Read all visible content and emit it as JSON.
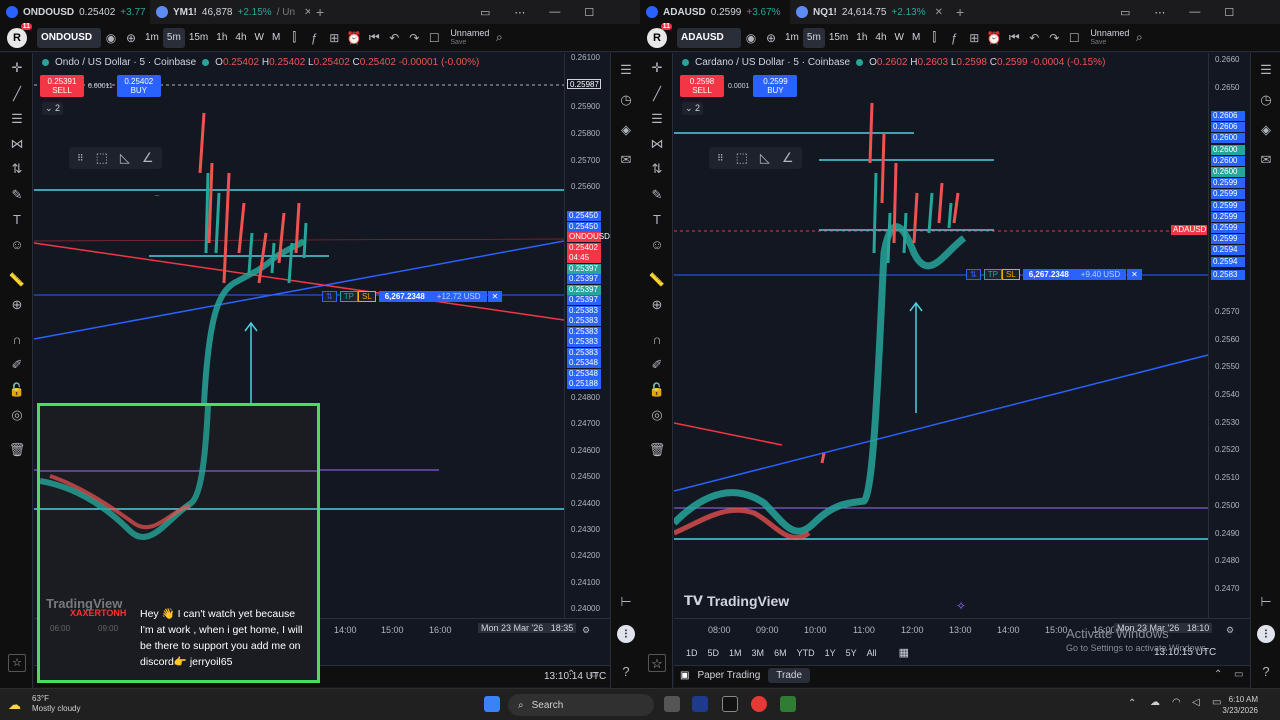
{
  "left": {
    "tabs": [
      {
        "symbol": "ONDOUSD",
        "price": "0.25402",
        "change": "+3.77",
        "active": true
      },
      {
        "symbol": "YM1!",
        "price": "46,878",
        "change": "+2.15%",
        "suffix": "/ Un",
        "active": false
      }
    ],
    "symbol_field": "ONDOUSD",
    "intervals": [
      "1m",
      "5m",
      "15m",
      "1h",
      "4h",
      "W",
      "M"
    ],
    "selected_interval": "5m",
    "layout_name": "Unnamed",
    "layout_sub": "Save",
    "legend": {
      "title": "Ondo / US Dollar · 5 · Coinbase",
      "o": "0.25402",
      "h": "0.25402",
      "l": "0.25402",
      "c": "0.25402",
      "chg": "-0.00001 (-0.00%)"
    },
    "sell": {
      "price": "0.25391",
      "label": "SELL"
    },
    "buy": {
      "price": "0.25402",
      "label": "BUY"
    },
    "spread": "0.00011",
    "collapse": "2",
    "price_levels": [
      "0.26100",
      "0.25900",
      "0.25800",
      "0.25700",
      "0.25600",
      "0.25500",
      "0.25200",
      "0.25100",
      "0.25000",
      "0.24900",
      "0.24800",
      "0.24700",
      "0.24600",
      "0.24500",
      "0.24400",
      "0.24300",
      "0.24200",
      "0.24100",
      "0.24000"
    ],
    "top_tag": "0.25987",
    "price_tags": [
      {
        "v": "0.25450",
        "c": "#2962ff"
      },
      {
        "v": "0.25450",
        "c": "#2962ff"
      },
      {
        "v": "ONDOUSD",
        "c": "#f23645"
      },
      {
        "v": "0.25402",
        "c": "#f23645"
      },
      {
        "v": "04:45",
        "c": "#f23645"
      },
      {
        "v": "0.25397",
        "c": "#26a69a"
      },
      {
        "v": "0.25397",
        "c": "#2962ff"
      },
      {
        "v": "0.25397",
        "c": "#26a69a"
      },
      {
        "v": "0.25397",
        "c": "#2962ff"
      },
      {
        "v": "0.25383",
        "c": "#2962ff"
      },
      {
        "v": "0.25383",
        "c": "#2962ff"
      },
      {
        "v": "0.25383",
        "c": "#2962ff"
      },
      {
        "v": "0.25383",
        "c": "#2962ff"
      },
      {
        "v": "0.25383",
        "c": "#2962ff"
      },
      {
        "v": "0.25348",
        "c": "#2962ff"
      },
      {
        "v": "0.25348",
        "c": "#2962ff"
      },
      {
        "v": "0.25188",
        "c": "#2962ff"
      }
    ],
    "position": {
      "qty": "6,267.2348",
      "pnl": "+12.72 USD",
      "tp": "TP",
      "sl": "SL"
    },
    "time_labels": [
      "14:00",
      "15:00",
      "16:00"
    ],
    "date_label": "Mon 23 Mar '26",
    "date_time": "18:35",
    "clock": "13:10:14 UTC"
  },
  "right": {
    "tabs": [
      {
        "symbol": "ADAUSD",
        "price": "0.2599",
        "change": "+3.67%",
        "active": true
      },
      {
        "symbol": "NQ1!",
        "price": "24,614.75",
        "change": "+2.13%",
        "active": false
      }
    ],
    "symbol_field": "ADAUSD",
    "intervals": [
      "1m",
      "5m",
      "15m",
      "1h",
      "4h",
      "W",
      "M"
    ],
    "selected_interval": "5m",
    "layout_name": "Unnamed",
    "layout_sub": "Save",
    "legend": {
      "title": "Cardano / US Dollar · 5 · Coinbase",
      "o": "0.2602",
      "h": "0.2603",
      "l": "0.2598",
      "c": "0.2599",
      "chg": "-0.0004 (-0.15%)"
    },
    "sell": {
      "price": "0.2598",
      "label": "SELL"
    },
    "buy": {
      "price": "0.2599",
      "label": "BUY"
    },
    "spread": "0.0001",
    "collapse": "2",
    "price_levels": [
      "0.2660",
      "0.2650",
      "0.2640",
      "0.2630",
      "0.2620",
      "0.2610",
      "0.2580",
      "0.2570",
      "0.2560",
      "0.2550",
      "0.2540",
      "0.2530",
      "0.2520",
      "0.2510",
      "0.2500",
      "0.2490",
      "0.2480",
      "0.2470"
    ],
    "price_tags": [
      {
        "v": "0.2606",
        "c": "#2962ff"
      },
      {
        "v": "0.2606",
        "c": "#2962ff"
      },
      {
        "v": "0.2600",
        "c": "#2962ff"
      },
      {
        "v": "0.2600",
        "c": "#26a69a"
      },
      {
        "v": "0.2600",
        "c": "#2962ff"
      },
      {
        "v": "0.2600",
        "c": "#26a69a"
      },
      {
        "v": "0.2599",
        "c": "#2962ff"
      },
      {
        "v": "0.2599",
        "c": "#2962ff"
      },
      {
        "v": "0.2599",
        "c": "#2962ff"
      },
      {
        "v": "0.2599",
        "c": "#2962ff"
      },
      {
        "v": "0.2599",
        "c": "#2962ff"
      },
      {
        "v": "0.2599",
        "c": "#2962ff"
      },
      {
        "v": "0.2594",
        "c": "#2962ff"
      },
      {
        "v": "0.2594",
        "c": "#2962ff"
      }
    ],
    "symbol_tag": "ADAUSD",
    "pos_tag": "0.2583",
    "position": {
      "qty": "6,267.2348",
      "pnl": "+9.40 USD",
      "tp": "TP",
      "sl": "SL"
    },
    "time_labels": [
      "08:00",
      "09:00",
      "10:00",
      "11:00",
      "12:00",
      "13:00",
      "14:00",
      "15:00",
      "16:00"
    ],
    "date_label": "Mon 23 Mar '26",
    "date_time": "18:10",
    "ranges": [
      "1D",
      "5D",
      "1M",
      "3M",
      "6M",
      "YTD",
      "1Y",
      "5Y",
      "All"
    ],
    "clock": "13:10:15 UTC",
    "paper_trading": "Paper Trading",
    "trade_btn": "Trade"
  },
  "tradingview_logo": "TradingView",
  "webcam": {
    "user": "XAXERTONH",
    "message": "Hey 👋 I can't watch yet because I'm at work , when i get home, I will be there to support you add me on discord👉 jerryoil65",
    "logo": "TradingView",
    "t1": "09:00",
    "t2": "06:00"
  },
  "watermark": {
    "title": "Activate Windows",
    "sub": "Go to Settings to activate Windows."
  },
  "taskbar": {
    "weather_temp": "63°F",
    "weather_desc": "Mostly cloudy",
    "search_placeholder": "Search",
    "time": "6:10 AM",
    "date": "3/23/2026"
  }
}
